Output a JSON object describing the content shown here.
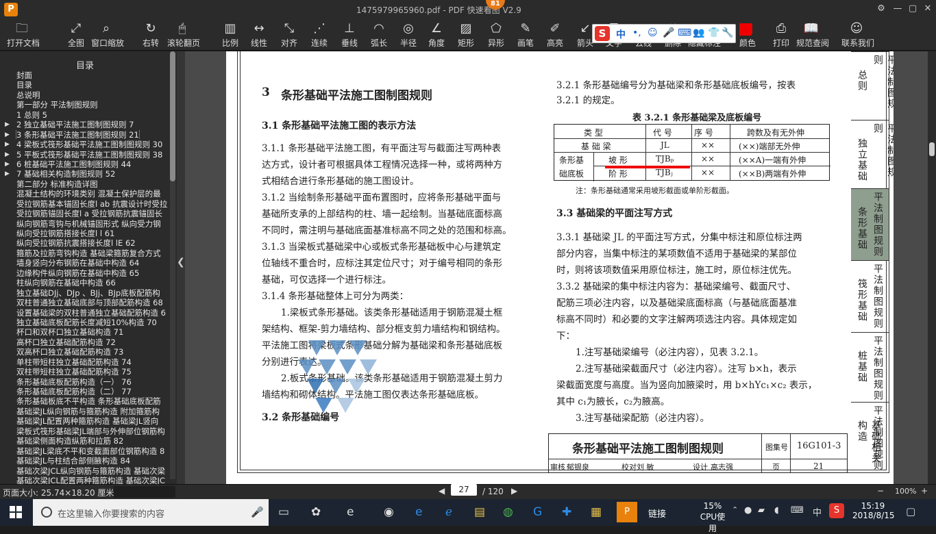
{
  "window": {
    "title": "1475979965960.pdf - PDF 快速看图 V2.9",
    "badge": "81",
    "controls": [
      "⚙",
      "—",
      "▢",
      "✕"
    ]
  },
  "toolbar": {
    "items": [
      {
        "icon": "folder-icon",
        "glyph": "🗀",
        "label": "打开文档"
      },
      {
        "icon": "fullscreen-icon",
        "glyph": "⤢",
        "label": "全图"
      },
      {
        "icon": "zoom-window-icon",
        "glyph": "⌕",
        "label": "窗口缩放"
      },
      {
        "icon": "rotate-icon",
        "glyph": "↻",
        "label": "右转"
      },
      {
        "icon": "mouse-scroll-icon",
        "glyph": "🖱",
        "label": "滚轮翻页"
      },
      {
        "icon": "scale-icon",
        "glyph": "▥",
        "label": "比例"
      },
      {
        "icon": "linear-measure-icon",
        "glyph": "↔",
        "label": "线性"
      },
      {
        "icon": "aligned-measure-icon",
        "glyph": "⤡",
        "label": "对齐"
      },
      {
        "icon": "continuous-measure-icon",
        "glyph": "⋰",
        "label": "连续"
      },
      {
        "icon": "perpendicular-icon",
        "glyph": "⊥",
        "label": "垂线"
      },
      {
        "icon": "arc-length-icon",
        "glyph": "◠",
        "label": "弧长"
      },
      {
        "icon": "radius-icon",
        "glyph": "◎",
        "label": "半径"
      },
      {
        "icon": "angle-icon",
        "glyph": "∠",
        "label": "角度"
      },
      {
        "icon": "rectangle-area-icon",
        "glyph": "▨",
        "label": "矩形"
      },
      {
        "icon": "polygon-area-icon",
        "glyph": "⬠",
        "label": "异形"
      },
      {
        "icon": "pen-icon",
        "glyph": "✎",
        "label": "画笔"
      },
      {
        "icon": "highlighter-icon",
        "glyph": "✐",
        "label": "高亮"
      },
      {
        "icon": "arrow-icon",
        "glyph": "↙",
        "label": "箭头"
      },
      {
        "icon": "text-icon",
        "glyph": "T",
        "label": "文字"
      },
      {
        "icon": "cloud-line-icon",
        "glyph": "☁",
        "label": "云线"
      },
      {
        "icon": "delete-icon",
        "glyph": "✖",
        "label": "删除"
      },
      {
        "icon": "hide-annotation-icon",
        "glyph": "◌",
        "label": "隐藏标注"
      },
      {
        "icon": "color-icon",
        "glyph": "■",
        "label": "颜色"
      },
      {
        "icon": "print-icon",
        "glyph": "⎙",
        "label": "打印"
      },
      {
        "icon": "standards-icon",
        "glyph": "📖",
        "label": "规范查阅"
      },
      {
        "icon": "contact-icon",
        "glyph": "☺",
        "label": "联系我们"
      }
    ]
  },
  "ime": {
    "logo": "S",
    "mode": "中",
    "items": [
      "•,",
      "☺",
      "🎤",
      "⌨",
      "👥",
      "👕",
      "🔧"
    ]
  },
  "sidebar": {
    "title": "目录",
    "items": [
      {
        "label": "封面",
        "arrow": ""
      },
      {
        "label": "目录",
        "arrow": ""
      },
      {
        "label": "总说明",
        "arrow": ""
      },
      {
        "label": "第一部分  平法制图规则",
        "arrow": ""
      },
      {
        "label": "1 总则 5",
        "arrow": ""
      },
      {
        "label": "2 独立基础平法施工图制图规则 7",
        "arrow": "▶"
      },
      {
        "label": "3 条形基础平法施工图制图规则 21",
        "arrow": "▶"
      },
      {
        "label": "4 梁板式筏形基础平法施工图制图规则 30",
        "arrow": "▶"
      },
      {
        "label": "5 平板式筏形基础平法施工图制图规则 38",
        "arrow": "▶"
      },
      {
        "label": "6 桩基础平法施工图制图规则 44",
        "arrow": "▶"
      },
      {
        "label": "7 基础相关构造制图规则 52",
        "arrow": "▶"
      },
      {
        "label": "第二部分  标准构造详图",
        "arrow": ""
      },
      {
        "label": "混凝土结构的环境类别 混凝土保护层的最",
        "arrow": ""
      },
      {
        "label": "受拉钢筋基本锚固长度l ab 抗震设计时受拉",
        "arrow": ""
      },
      {
        "label": "受拉钢筋锚固长度l a 受拉钢筋抗震锚固长",
        "arrow": ""
      },
      {
        "label": "纵向钢筋弯钩与机械锚固形式 纵向受力钢",
        "arrow": ""
      },
      {
        "label": "纵向受拉钢筋搭接长度l l  61",
        "arrow": ""
      },
      {
        "label": "纵向受拉钢筋抗震搭接长度l lE 62",
        "arrow": ""
      },
      {
        "label": "箍筋及拉筋弯钩构造 基础梁箍筋复合方式",
        "arrow": ""
      },
      {
        "label": "墙身竖向分布钢筋在基础中构造 64",
        "arrow": ""
      },
      {
        "label": "边缘构件纵向钢筋在基础中构造 65",
        "arrow": ""
      },
      {
        "label": "柱纵向钢筋在基础中构造 66",
        "arrow": ""
      },
      {
        "label": "独立基础DJj、DJp 、BJj、BJp底板配筋构",
        "arrow": ""
      },
      {
        "label": "双柱普通独立基础底部与顶部配筋构造 68",
        "arrow": ""
      },
      {
        "label": "设置基础梁的双柱普通独立基础配筋构造 6",
        "arrow": ""
      },
      {
        "label": "独立基础底板配筋长度减短10%构造 70",
        "arrow": ""
      },
      {
        "label": "杯口和双杯口独立基础构造 71",
        "arrow": ""
      },
      {
        "label": "高杯口独立基础配筋构造 72",
        "arrow": ""
      },
      {
        "label": "双高杯口独立基础配筋构造 73",
        "arrow": ""
      },
      {
        "label": "单柱带短柱独立基础配筋构造 74",
        "arrow": ""
      },
      {
        "label": "双柱带短柱独立基础配筋构造 75",
        "arrow": ""
      },
      {
        "label": "条形基础底板配筋构造（一） 76",
        "arrow": ""
      },
      {
        "label": "条形基础底板配筋构造（二） 77",
        "arrow": ""
      },
      {
        "label": "条形基础板底不平构造 条形基础底板配筋",
        "arrow": ""
      },
      {
        "label": "基础梁JL纵向钢筋与箍筋构造 附加箍筋构",
        "arrow": ""
      },
      {
        "label": "基础梁JL配置两种箍筋构造 基础梁JL竖向",
        "arrow": ""
      },
      {
        "label": "梁板式筏形基础梁JL端部与外伸部位钢筋构",
        "arrow": ""
      },
      {
        "label": "基础梁侧面构造纵筋和拉筋 82",
        "arrow": ""
      },
      {
        "label": "基础梁JL梁底不平和变截面部位钢筋构造 8",
        "arrow": ""
      },
      {
        "label": "基础梁JL与柱结合部侧腋构造 84",
        "arrow": ""
      },
      {
        "label": "基础次梁JCL纵向钢筋与箍筋构造 基础次梁",
        "arrow": ""
      },
      {
        "label": "基础次梁JCL配置两种箍筋构造 基础次梁JC",
        "arrow": ""
      },
      {
        "label": "基础次梁JCL梁底不平和变截面部位钢筋构",
        "arrow": ""
      }
    ],
    "selected_index": 6
  },
  "page": {
    "h3_num": "3",
    "h3_title": "条形基础平法施工图制图规则",
    "s31": "3.1 条形基础平法施工图的表示方法",
    "p311": [
      "3.1.1 条形基础平法施工图，有平面注写与截面注写两种表",
      "达方式，设计者可根据具体工程情况选择一种，或将两种方",
      "式相结合进行条形基础的施工图设计。"
    ],
    "p312": [
      "3.1.2 当绘制条形基础平面布置图时，应将条形基础平面与",
      "基础所支承的上部结构的柱、墙一起绘制。当基础底面标高",
      "不同时，需注明与基础底面基准标高不同之处的范围和标高。"
    ],
    "p313": [
      "3.1.3 当梁板式基础梁中心或板式条形基础板中心与建筑定",
      "位轴线不重合时，应标注其定位尺寸；对于编号相同的条形",
      "基础，可仅选择一个进行标注。"
    ],
    "p314": "3.1.4 条形基础整体上可分为两类：",
    "p314a": [
      "1.梁板式条形基础。该类条形基础适用于钢筋混凝土框",
      "架结构、框架-剪力墙结构、部分框支剪力墙结构和钢结构。",
      "平法施工图将梁板式条形基础分解为基础梁和条形基础底板",
      "分别进行表达。"
    ],
    "p314b": [
      "2.板式条形基础。该类条形基础适用于钢筋混凝土剪力",
      "墙结构和砌体结构。平法施工图仅表达条形基础底板。"
    ],
    "s32": "3.2 条形基础编号",
    "p321": [
      "3.2.1 条形基础编号分为基础梁和条形基础底板编号，按表",
      "3.2.1 的规定。"
    ],
    "table_caption": "表 3.2.1   条形基础梁及底板编号",
    "table_header": [
      "类  型",
      "代 号",
      "序 号",
      "跨数及有无外伸"
    ],
    "table_rows": [
      [
        "基 础 梁",
        "JL",
        "××",
        "(××)端部无外伸"
      ],
      [
        "坡 形",
        "TJBₚ",
        "××",
        "(××A)一端有外伸"
      ],
      [
        "阶 形",
        "TJBⱼ",
        "××",
        "(××B)两端有外伸"
      ]
    ],
    "table_group": [
      "条形基",
      "础底板"
    ],
    "table_note": "注：条形基础通常采用坡形截面或单阶形截面。",
    "s33": "3.3 基础梁的平面注写方式",
    "p331": [
      "3.3.1 基础梁 JL 的平面注写方式，分集中标注和原位标注两",
      "部分内容，当集中标注的某项数值不适用于基础梁的某部位",
      "时，则将该项数值采用原位标注，施工时，原位标注优先。"
    ],
    "p332": [
      "3.3.2 基础梁的集中标注内容为：基础梁编号、截面尺寸、",
      "配筋三项必注内容，以及基础梁底面标高（与基础底面基准",
      "标高不同时）和必要的文字注解两项选注内容。具体规定如",
      "下："
    ],
    "p332a": "1.注写基础梁编号（必注内容），见表 3.2.1。",
    "p332b": [
      "2.注写基础梁截面尺寸（必注内容）。注写 b×h，表示",
      "梁截面宽度与高度。当为竖向加腋梁时，用 b×hYc₁×c₂ 表示，",
      "其中 c₁为腋长，c₂为腋高。"
    ],
    "p332c": "3.注写基础梁配筋（必注内容）。",
    "title_block": {
      "title": "条形基础平法施工图制图规则",
      "atlas_label": "图集号",
      "atlas": "16G101-3",
      "row": [
        "审核",
        "郁银泉",
        "校对",
        "刘 敏",
        "设计",
        "高志强",
        "页"
      ],
      "page": "21"
    },
    "tabs": [
      {
        "v1": "平法制图规则",
        "v2": "总则"
      },
      {
        "v1": "平法制图规则",
        "v2": "独立基础"
      },
      {
        "v1": "平法制图规则",
        "v2": "条形基础"
      },
      {
        "v1": "平法制图规则",
        "v2": "筏形基础"
      },
      {
        "v1": "平法制图规则",
        "v2": "桩基础"
      },
      {
        "v1": "平法制图规则",
        "v2": "基础相关构造"
      }
    ]
  },
  "status": {
    "page_size": "页面大小: 25.74×18.20 厘米",
    "page_current": "27",
    "page_total": "/ 120",
    "zoom": "100%"
  },
  "taskbar": {
    "search_placeholder": "在这里输入你要搜索的内容",
    "cpu_percent": "15%",
    "cpu_label": "CPU使用",
    "time": "15:19",
    "date": "2018/8/15",
    "tray_link": "链接",
    "lang": "中"
  }
}
